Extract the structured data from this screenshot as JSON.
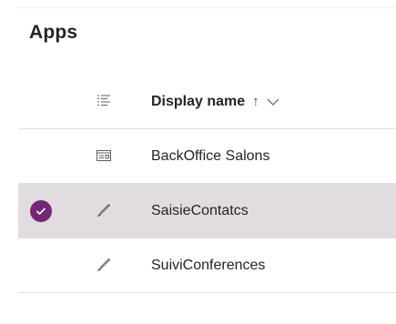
{
  "page": {
    "title": "Apps"
  },
  "table": {
    "header": {
      "column_icon": "list-view-icon",
      "display_name_label": "Display name",
      "sort_arrow": "↑",
      "sort_menu_icon": "chevron-down-icon"
    },
    "rows": [
      {
        "icon": "model-driven-app-icon",
        "name": "BackOffice Salons",
        "selected": false
      },
      {
        "icon": "canvas-app-icon",
        "name": "SaisieContatcs",
        "selected": true
      },
      {
        "icon": "canvas-app-icon",
        "name": "SuiviConferences",
        "selected": false
      }
    ]
  },
  "colors": {
    "selected_row_bg": "#e1dcdf",
    "check_circle": "#742774",
    "divider": "#e1dfdd",
    "text": "#252423"
  }
}
